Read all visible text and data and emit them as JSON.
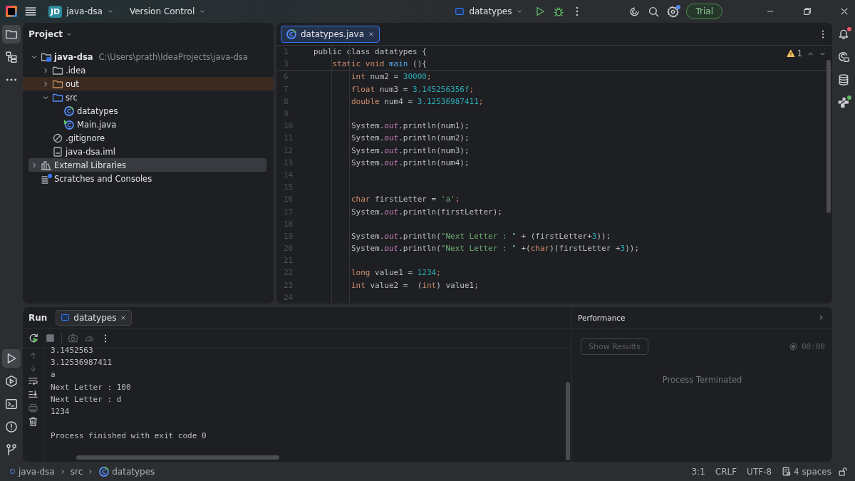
{
  "title_bar": {
    "badge": "JD",
    "project": "java-dsa",
    "vcs": "Version Control",
    "run_config": "datatypes",
    "trial": "Trial"
  },
  "left_tools": [
    {
      "kind": "project",
      "selected": true
    },
    {
      "kind": "structure",
      "selected": false
    },
    {
      "kind": "more",
      "selected": false
    }
  ],
  "left_bottom_tools": [
    {
      "kind": "run",
      "selected": true
    },
    {
      "kind": "services",
      "selected": false
    },
    {
      "kind": "terminal",
      "selected": false
    },
    {
      "kind": "problems",
      "selected": false
    },
    {
      "kind": "git",
      "selected": false
    }
  ],
  "right_tools": [
    {
      "kind": "notifications",
      "alert": true
    },
    {
      "kind": "assistant",
      "alert": false
    },
    {
      "kind": "database",
      "alert": false
    },
    {
      "kind": "plugin",
      "alert": true
    }
  ],
  "project_panel": {
    "title": "Project",
    "tree": [
      {
        "name": "java-dsa",
        "path": "C:\\Users\\prath\\IdeaProjects\\java-dsa",
        "kind": "module",
        "expanded": true,
        "selected": false,
        "children": [
          {
            "name": ".idea",
            "kind": "folder",
            "expanded": false,
            "selected": false
          },
          {
            "name": "out",
            "kind": "excluded_folder",
            "expanded": false,
            "selected": false
          },
          {
            "name": "src",
            "kind": "source_folder",
            "expanded": true,
            "selected": false,
            "children": [
              {
                "name": "datatypes",
                "kind": "class",
                "selected": false
              },
              {
                "name": "Main.java",
                "kind": "main_class",
                "selected": false
              }
            ]
          },
          {
            "name": ".gitignore",
            "kind": "ignore_file",
            "selected": false
          },
          {
            "name": "java-dsa.iml",
            "kind": "module_file",
            "selected": false
          }
        ]
      },
      {
        "name": "External Libraries",
        "kind": "libraries",
        "expanded": false,
        "selected": true
      },
      {
        "name": "Scratches and Consoles",
        "kind": "scratches",
        "selected": false
      }
    ]
  },
  "editor": {
    "tabs": [
      {
        "label": "datatypes.java",
        "selected": true
      }
    ],
    "warning_count": "1",
    "sticky_lines": [
      {
        "number": "1",
        "tokens": [
          {
            "text": "public class datatypes {",
            "kind": "plain"
          }
        ]
      },
      {
        "number": "3",
        "tokens": [
          {
            "text": "    static void ",
            "kind": "keyword"
          },
          {
            "text": "main",
            "kind": "method"
          },
          {
            "text": " (){",
            "kind": "plain"
          }
        ]
      }
    ],
    "lines": [
      {
        "number": "6",
        "tokens": [
          {
            "text": "        int",
            "kind": "keyword"
          },
          {
            "text": " num2 = ",
            "kind": "plain"
          },
          {
            "text": "30000",
            "kind": "number"
          },
          {
            "text": ";",
            "kind": "keyword"
          }
        ]
      },
      {
        "number": "7",
        "tokens": [
          {
            "text": "        float",
            "kind": "keyword"
          },
          {
            "text": " num3 = ",
            "kind": "plain"
          },
          {
            "text": "3.145256356f",
            "kind": "number"
          },
          {
            "text": ";",
            "kind": "keyword"
          }
        ]
      },
      {
        "number": "8",
        "tokens": [
          {
            "text": "        double",
            "kind": "keyword"
          },
          {
            "text": " num4 = ",
            "kind": "plain"
          },
          {
            "text": "3.12536987411",
            "kind": "number"
          },
          {
            "text": ";",
            "kind": "keyword"
          }
        ]
      },
      {
        "number": "9"
      },
      {
        "number": "10",
        "tokens": [
          {
            "text": "        System.",
            "kind": "plain"
          },
          {
            "text": "out",
            "kind": "field"
          },
          {
            "text": ".println(num1);",
            "kind": "plain"
          }
        ]
      },
      {
        "number": "11",
        "tokens": [
          {
            "text": "        System.",
            "kind": "plain"
          },
          {
            "text": "out",
            "kind": "field"
          },
          {
            "text": ".println(num2);",
            "kind": "plain"
          }
        ]
      },
      {
        "number": "12",
        "tokens": [
          {
            "text": "        System.",
            "kind": "plain"
          },
          {
            "text": "out",
            "kind": "field"
          },
          {
            "text": ".println(num3);",
            "kind": "plain"
          }
        ]
      },
      {
        "number": "13",
        "tokens": [
          {
            "text": "        System.",
            "kind": "plain"
          },
          {
            "text": "out",
            "kind": "field"
          },
          {
            "text": ".println(num4);",
            "kind": "plain"
          }
        ]
      },
      {
        "number": "14"
      },
      {
        "number": "15"
      },
      {
        "number": "16",
        "tokens": [
          {
            "text": "        char",
            "kind": "keyword"
          },
          {
            "text": " firstLetter = ",
            "kind": "plain"
          },
          {
            "text": "'a'",
            "kind": "string"
          },
          {
            "text": ";",
            "kind": "keyword"
          }
        ]
      },
      {
        "number": "17",
        "tokens": [
          {
            "text": "        System.",
            "kind": "plain"
          },
          {
            "text": "out",
            "kind": "field"
          },
          {
            "text": ".println(firstLetter);",
            "kind": "plain"
          }
        ]
      },
      {
        "number": "18"
      },
      {
        "number": "19",
        "tokens": [
          {
            "text": "        System.",
            "kind": "plain"
          },
          {
            "text": "out",
            "kind": "field"
          },
          {
            "text": ".println(",
            "kind": "plain"
          },
          {
            "text": "\"Next Letter : \"",
            "kind": "string"
          },
          {
            "text": " + (firstLetter+",
            "kind": "plain"
          },
          {
            "text": "3",
            "kind": "number"
          },
          {
            "text": "));",
            "kind": "plain"
          }
        ]
      },
      {
        "number": "20",
        "tokens": [
          {
            "text": "        System.",
            "kind": "plain"
          },
          {
            "text": "out",
            "kind": "field"
          },
          {
            "text": ".println(",
            "kind": "plain"
          },
          {
            "text": "\"Next Letter : \"",
            "kind": "string"
          },
          {
            "text": " +(",
            "kind": "plain"
          },
          {
            "text": "char",
            "kind": "keyword"
          },
          {
            "text": ")(firstLetter +",
            "kind": "plain"
          },
          {
            "text": "3",
            "kind": "number"
          },
          {
            "text": "));",
            "kind": "plain"
          }
        ]
      },
      {
        "number": "21"
      },
      {
        "number": "22",
        "tokens": [
          {
            "text": "        long",
            "kind": "keyword"
          },
          {
            "text": " value1 = ",
            "kind": "plain"
          },
          {
            "text": "1234",
            "kind": "number"
          },
          {
            "text": ";",
            "kind": "keyword"
          }
        ]
      },
      {
        "number": "23",
        "tokens": [
          {
            "text": "        int",
            "kind": "keyword"
          },
          {
            "text": " value2 =  (",
            "kind": "plain"
          },
          {
            "text": "int",
            "kind": "keyword"
          },
          {
            "text": ") value1;",
            "kind": "plain"
          }
        ]
      },
      {
        "number": "24"
      }
    ]
  },
  "run_panel": {
    "title": "Run",
    "tabs": [
      {
        "label": "datatypes",
        "selected": true
      }
    ],
    "output": [
      {
        "text": "3.1452563",
        "kind": "stdout"
      },
      {
        "text": "3.12536987411",
        "kind": "stdout"
      },
      {
        "text": "a",
        "kind": "stdout"
      },
      {
        "text": "Next Letter : 100",
        "kind": "stdout"
      },
      {
        "text": "Next Letter : d",
        "kind": "stdout"
      },
      {
        "text": "1234",
        "kind": "stdout"
      },
      {
        "text": "Process finished with exit code 0",
        "kind": "exit"
      }
    ],
    "performance": {
      "title": "Performance",
      "button": {
        "label": "Show Results",
        "disabled": true
      },
      "timer": "00:00",
      "status": "Process Terminated"
    }
  },
  "status_bar": {
    "breadcrumbs": [
      {
        "label": "java-dsa",
        "kind": "module"
      },
      {
        "label": "src",
        "kind": "folder"
      },
      {
        "label": "datatypes",
        "kind": "class"
      }
    ],
    "items": [
      "3:1",
      "CRLF",
      "UTF-8",
      "4 spaces"
    ]
  }
}
